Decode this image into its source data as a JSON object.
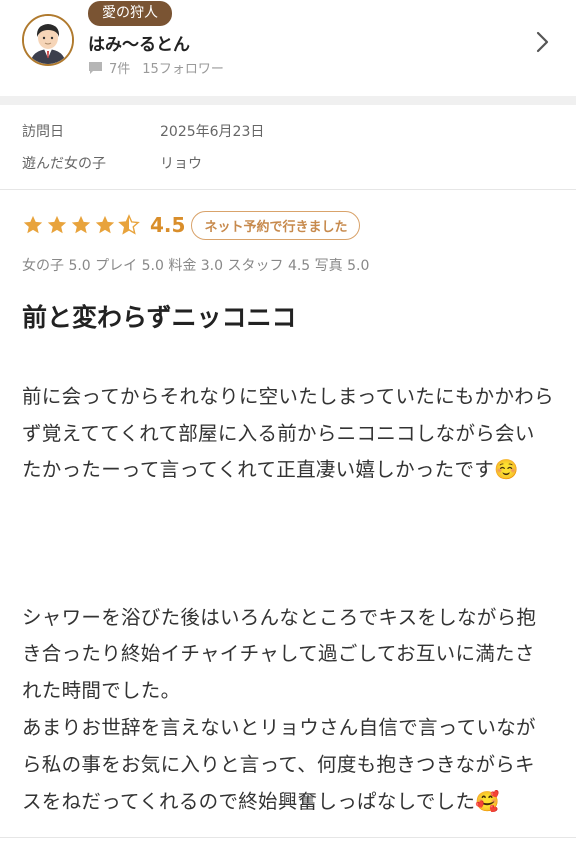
{
  "profile": {
    "badge": "愛の狩人",
    "username": "はみ〜るとん",
    "reviews": "7件",
    "followers": "15フォロワー"
  },
  "visit": {
    "date_label": "訪問日",
    "date_value": "2025年6月23日",
    "girl_label": "遊んだ女の子",
    "girl_value": "リョウ"
  },
  "rating": {
    "score": "4.5",
    "stars": 4.5,
    "booking_badge": "ネット予約で行きました",
    "breakdown": "女の子 5.0  プレイ 5.0  料金 3.0  スタッフ 4.5  写真 5.0"
  },
  "review": {
    "title": "前と変わらずニッコニコ",
    "body_p1": "前に会ってからそれなりに空いたしまっていたにもかかわらず覚えててくれて部屋に入る前からニコニコしながら会いたかったーって言ってくれて正直凄い嬉しかったです☺️",
    "body_p2": "シャワーを浴びた後はいろんなところでキスをしながら抱き合ったり終始イチャイチャして過ごしてお互いに満たされた時間でした。\nあまりお世辞を言えないとリョウさん自信で言っていながら私の事をお気に入りと言って、何度も抱きつきながらキスをねだってくれるので終始興奮しっぱなしでした🥰"
  },
  "colors": {
    "star": "#e8a33c",
    "badge_bg": "#7a5433",
    "accent": "#d98e2b"
  }
}
